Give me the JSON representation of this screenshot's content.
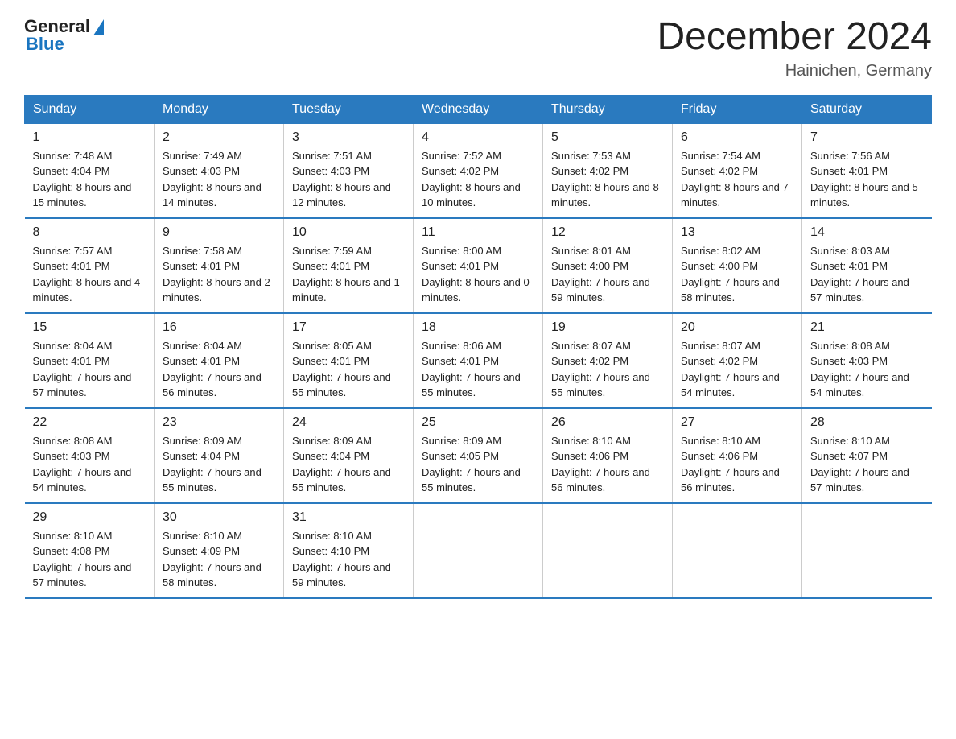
{
  "logo": {
    "text_general": "General",
    "triangle": "▶",
    "text_blue": "Blue"
  },
  "header": {
    "month": "December 2024",
    "location": "Hainichen, Germany"
  },
  "days_of_week": [
    "Sunday",
    "Monday",
    "Tuesday",
    "Wednesday",
    "Thursday",
    "Friday",
    "Saturday"
  ],
  "weeks": [
    [
      {
        "day": 1,
        "sunrise": "7:48 AM",
        "sunset": "4:04 PM",
        "daylight": "8 hours and 15 minutes."
      },
      {
        "day": 2,
        "sunrise": "7:49 AM",
        "sunset": "4:03 PM",
        "daylight": "8 hours and 14 minutes."
      },
      {
        "day": 3,
        "sunrise": "7:51 AM",
        "sunset": "4:03 PM",
        "daylight": "8 hours and 12 minutes."
      },
      {
        "day": 4,
        "sunrise": "7:52 AM",
        "sunset": "4:02 PM",
        "daylight": "8 hours and 10 minutes."
      },
      {
        "day": 5,
        "sunrise": "7:53 AM",
        "sunset": "4:02 PM",
        "daylight": "8 hours and 8 minutes."
      },
      {
        "day": 6,
        "sunrise": "7:54 AM",
        "sunset": "4:02 PM",
        "daylight": "8 hours and 7 minutes."
      },
      {
        "day": 7,
        "sunrise": "7:56 AM",
        "sunset": "4:01 PM",
        "daylight": "8 hours and 5 minutes."
      }
    ],
    [
      {
        "day": 8,
        "sunrise": "7:57 AM",
        "sunset": "4:01 PM",
        "daylight": "8 hours and 4 minutes."
      },
      {
        "day": 9,
        "sunrise": "7:58 AM",
        "sunset": "4:01 PM",
        "daylight": "8 hours and 2 minutes."
      },
      {
        "day": 10,
        "sunrise": "7:59 AM",
        "sunset": "4:01 PM",
        "daylight": "8 hours and 1 minute."
      },
      {
        "day": 11,
        "sunrise": "8:00 AM",
        "sunset": "4:01 PM",
        "daylight": "8 hours and 0 minutes."
      },
      {
        "day": 12,
        "sunrise": "8:01 AM",
        "sunset": "4:00 PM",
        "daylight": "7 hours and 59 minutes."
      },
      {
        "day": 13,
        "sunrise": "8:02 AM",
        "sunset": "4:00 PM",
        "daylight": "7 hours and 58 minutes."
      },
      {
        "day": 14,
        "sunrise": "8:03 AM",
        "sunset": "4:01 PM",
        "daylight": "7 hours and 57 minutes."
      }
    ],
    [
      {
        "day": 15,
        "sunrise": "8:04 AM",
        "sunset": "4:01 PM",
        "daylight": "7 hours and 57 minutes."
      },
      {
        "day": 16,
        "sunrise": "8:04 AM",
        "sunset": "4:01 PM",
        "daylight": "7 hours and 56 minutes."
      },
      {
        "day": 17,
        "sunrise": "8:05 AM",
        "sunset": "4:01 PM",
        "daylight": "7 hours and 55 minutes."
      },
      {
        "day": 18,
        "sunrise": "8:06 AM",
        "sunset": "4:01 PM",
        "daylight": "7 hours and 55 minutes."
      },
      {
        "day": 19,
        "sunrise": "8:07 AM",
        "sunset": "4:02 PM",
        "daylight": "7 hours and 55 minutes."
      },
      {
        "day": 20,
        "sunrise": "8:07 AM",
        "sunset": "4:02 PM",
        "daylight": "7 hours and 54 minutes."
      },
      {
        "day": 21,
        "sunrise": "8:08 AM",
        "sunset": "4:03 PM",
        "daylight": "7 hours and 54 minutes."
      }
    ],
    [
      {
        "day": 22,
        "sunrise": "8:08 AM",
        "sunset": "4:03 PM",
        "daylight": "7 hours and 54 minutes."
      },
      {
        "day": 23,
        "sunrise": "8:09 AM",
        "sunset": "4:04 PM",
        "daylight": "7 hours and 55 minutes."
      },
      {
        "day": 24,
        "sunrise": "8:09 AM",
        "sunset": "4:04 PM",
        "daylight": "7 hours and 55 minutes."
      },
      {
        "day": 25,
        "sunrise": "8:09 AM",
        "sunset": "4:05 PM",
        "daylight": "7 hours and 55 minutes."
      },
      {
        "day": 26,
        "sunrise": "8:10 AM",
        "sunset": "4:06 PM",
        "daylight": "7 hours and 56 minutes."
      },
      {
        "day": 27,
        "sunrise": "8:10 AM",
        "sunset": "4:06 PM",
        "daylight": "7 hours and 56 minutes."
      },
      {
        "day": 28,
        "sunrise": "8:10 AM",
        "sunset": "4:07 PM",
        "daylight": "7 hours and 57 minutes."
      }
    ],
    [
      {
        "day": 29,
        "sunrise": "8:10 AM",
        "sunset": "4:08 PM",
        "daylight": "7 hours and 57 minutes."
      },
      {
        "day": 30,
        "sunrise": "8:10 AM",
        "sunset": "4:09 PM",
        "daylight": "7 hours and 58 minutes."
      },
      {
        "day": 31,
        "sunrise": "8:10 AM",
        "sunset": "4:10 PM",
        "daylight": "7 hours and 59 minutes."
      },
      null,
      null,
      null,
      null
    ]
  ]
}
